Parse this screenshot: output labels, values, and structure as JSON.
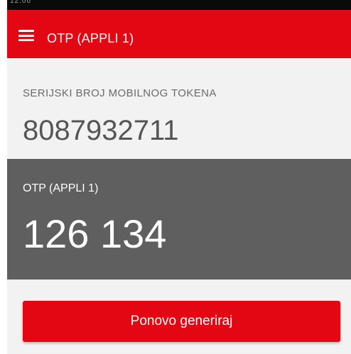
{
  "status_bar": {
    "time": "12:00",
    "right": ""
  },
  "app_bar": {
    "title": "OTP (APPLI 1)",
    "menu_icon": "hamburger-menu-icon"
  },
  "serial": {
    "label": "SERIJSKI BROJ MOBILNOG TOKENA",
    "value": "8087932711"
  },
  "otp": {
    "label": "OTP (APPLI 1)",
    "value": "126 134"
  },
  "actions": {
    "regenerate_label": "Ponovo generiraj"
  },
  "colors": {
    "accent": "#e30613",
    "otp_background": "#5f5f5f",
    "page_background": "#f2f2f2"
  }
}
